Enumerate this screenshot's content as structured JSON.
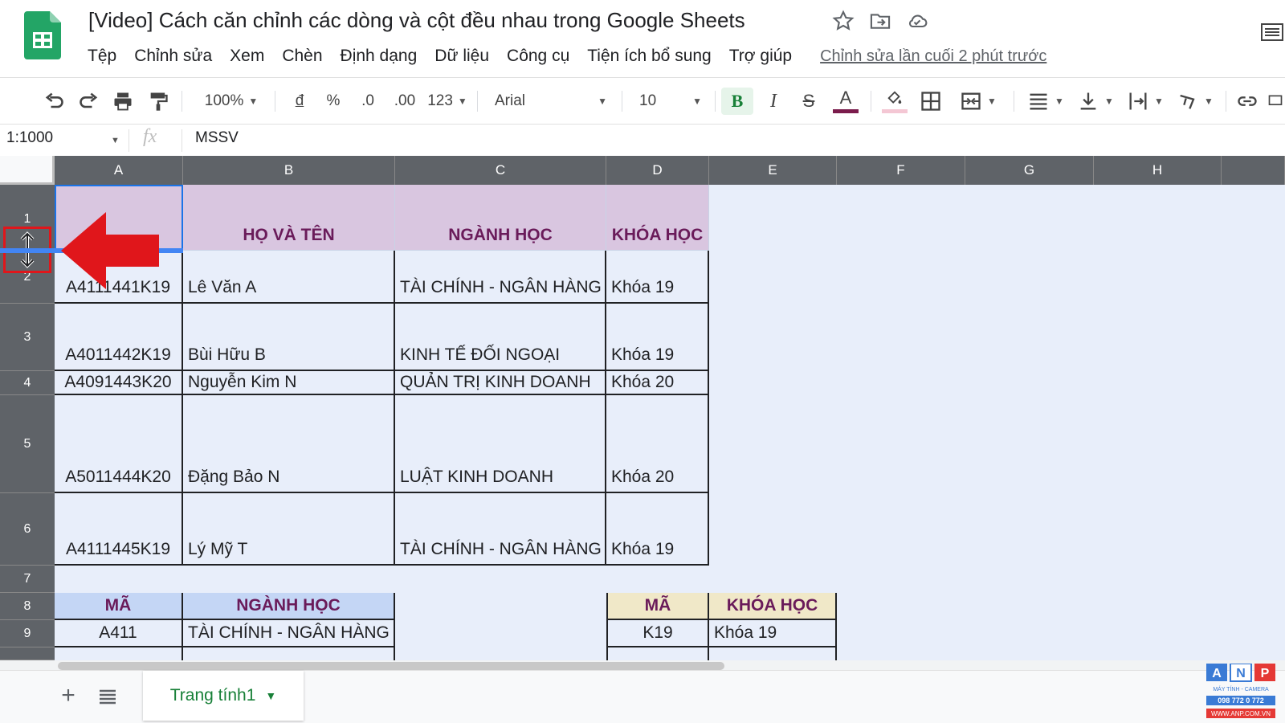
{
  "header": {
    "title": "[Video] Cách căn chỉnh các dòng và cột đều nhau trong Google Sheets",
    "menu": [
      "Tệp",
      "Chỉnh sửa",
      "Xem",
      "Chèn",
      "Định dạng",
      "Dữ liệu",
      "Công cụ",
      "Tiện ích bổ sung",
      "Trợ giúp"
    ],
    "last_edit": "Chỉnh sửa lần cuối 2 phút trước",
    "icons": [
      "sheets-logo-icon",
      "star-icon",
      "move-folder-icon",
      "cloud-status-icon",
      "side-panel-icon"
    ]
  },
  "toolbar": {
    "zoom": "100%",
    "currency": "đ",
    "percent": "%",
    "decrease_decimal": ".0",
    "increase_decimal": ".00",
    "more_formats": "123",
    "font": "Arial",
    "font_size": "10",
    "bold": "B",
    "italic": "I",
    "strike": "S",
    "text_color_letter": "A",
    "text_color": "#7b1c4c"
  },
  "formula_bar": {
    "name_box": "1:1000",
    "fx": "fx",
    "value": "MSSV"
  },
  "grid": {
    "columns": [
      "A",
      "B",
      "C",
      "D",
      "E",
      "F",
      "G",
      "H"
    ],
    "rows": [
      "1",
      "2",
      "3",
      "4",
      "5",
      "6",
      "7",
      "8",
      "9"
    ],
    "header_row": [
      "",
      "HỌ VÀ TÊN",
      "NGÀNH HỌC",
      "KHÓA HỌC"
    ],
    "data": [
      [
        "A4111441K19",
        "Lê Văn A",
        "TÀI CHÍNH - NGÂN HÀNG",
        "Khóa 19"
      ],
      [
        "A4011442K19",
        "Bùi Hữu B",
        "KINH TẾ ĐỐI NGOẠI",
        "Khóa 19"
      ],
      [
        "A4091443K20",
        "Nguyễn Kim N",
        "QUẢN TRỊ KINH DOANH",
        "Khóa 20"
      ],
      [
        "A5011444K20",
        "Đặng Bảo N",
        "LUẬT KINH DOANH",
        "Khóa 20"
      ],
      [
        "A4111445K19",
        "Lý Mỹ T",
        "TÀI CHÍNH - NGÂN HÀNG",
        "Khóa 19"
      ]
    ],
    "lookup_major": {
      "headers": [
        "MÃ",
        "NGÀNH HỌC"
      ],
      "row": [
        "A411",
        "TÀI CHÍNH - NGÂN HÀNG"
      ]
    },
    "lookup_course": {
      "headers": [
        "MÃ",
        "KHÓA HỌC"
      ],
      "row": [
        "K19",
        "Khóa 19"
      ]
    },
    "colors": {
      "header_purple": "#d9c6e0",
      "header_text": "#6a1b5a",
      "lookup_blue": "#c4d6f5",
      "lookup_tan": "#f0e8c8",
      "selection_fill": "#e8eefa",
      "annotation_red": "#e0161b"
    }
  },
  "sheets": {
    "active_tab": "Trang tính1"
  },
  "watermark": {
    "letters": [
      "A",
      "N",
      "P"
    ],
    "line1": "MÁY TÍNH - CAMERA",
    "line2": "098 772 0 772",
    "line3": "WWW.ANP.COM.VN"
  }
}
